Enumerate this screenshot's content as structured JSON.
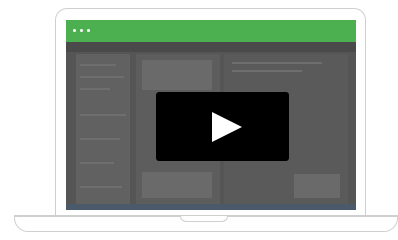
{
  "window": {
    "titlebar_color": "#4caf50",
    "titlebar_dots": 3
  },
  "video": {
    "play_icon": "play-icon",
    "overlay_color": "#000000"
  },
  "device": {
    "type": "laptop-illustration",
    "frame_color": "#cfcfcf"
  }
}
